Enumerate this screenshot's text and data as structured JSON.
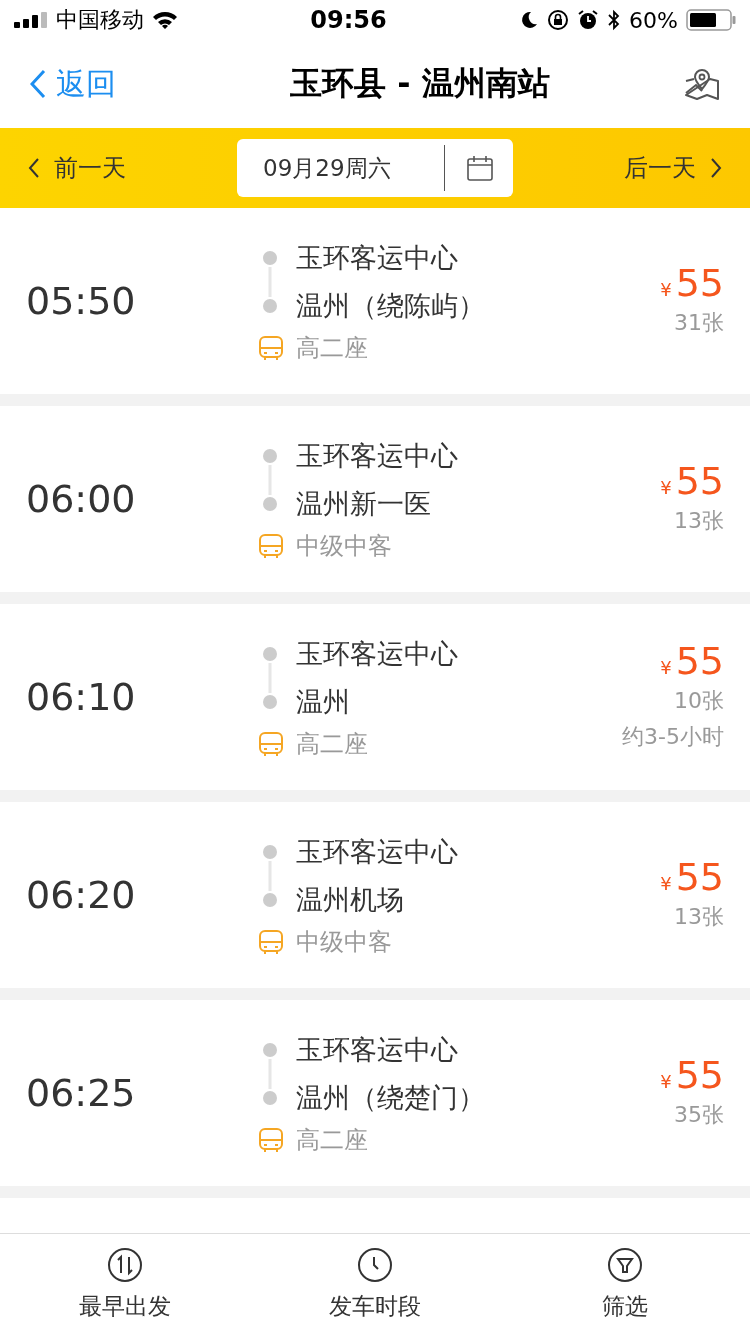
{
  "status_bar": {
    "carrier": "中国移动",
    "time": "09:56",
    "battery_text": "60%"
  },
  "nav": {
    "back": "返回",
    "title": "玉环县 - 温州南站"
  },
  "date_bar": {
    "prev": "前一天",
    "date": "09月29周六",
    "next": "后一天"
  },
  "trips": [
    {
      "time": "05:50",
      "from": "玉环客运中心",
      "to": "温州（绕陈屿）",
      "bus_type": "高二座",
      "currency": "¥",
      "price": "55",
      "tickets": "31张"
    },
    {
      "time": "06:00",
      "from": "玉环客运中心",
      "to": "温州新一医",
      "bus_type": "中级中客",
      "currency": "¥",
      "price": "55",
      "tickets": "13张"
    },
    {
      "time": "06:10",
      "from": "玉环客运中心",
      "to": "温州",
      "bus_type": "高二座",
      "currency": "¥",
      "price": "55",
      "tickets": "10张",
      "duration": "约3-5小时"
    },
    {
      "time": "06:20",
      "from": "玉环客运中心",
      "to": "温州机场",
      "bus_type": "中级中客",
      "currency": "¥",
      "price": "55",
      "tickets": "13张"
    },
    {
      "time": "06:25",
      "from": "玉环客运中心",
      "to": "温州（绕楚门）",
      "bus_type": "高二座",
      "currency": "¥",
      "price": "55",
      "tickets": "35张"
    }
  ],
  "tab_bar": [
    {
      "kind": "sort",
      "label": "最早出发"
    },
    {
      "kind": "clock",
      "label": "发车时段"
    },
    {
      "kind": "filter",
      "label": "筛选"
    }
  ]
}
